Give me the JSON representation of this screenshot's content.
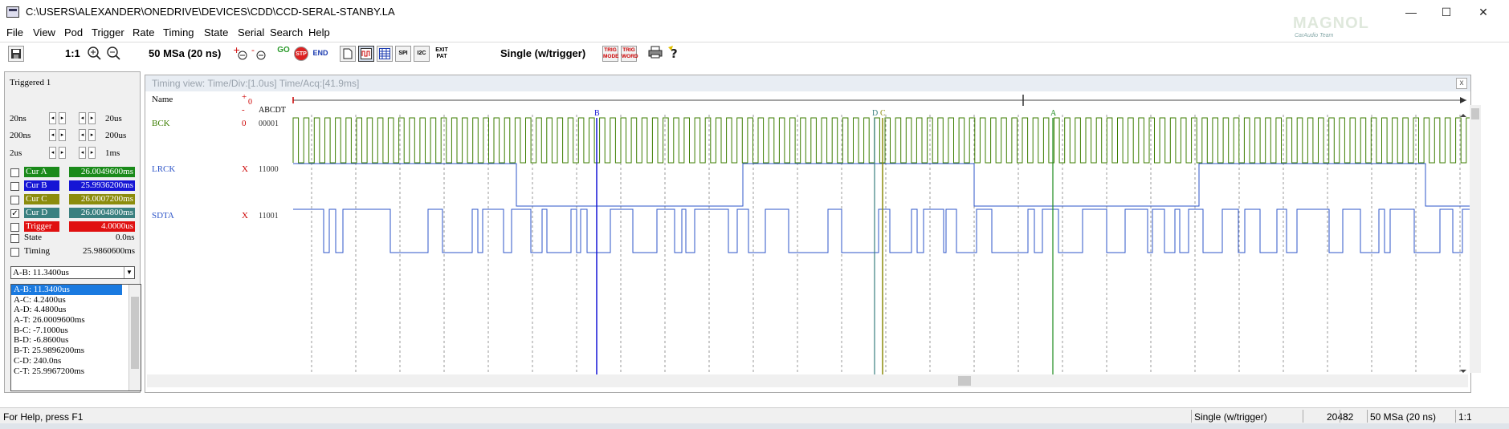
{
  "window": {
    "title": "C:\\USERS\\ALEXANDER\\ONEDRIVE\\DEVICES\\CDD\\CCD-SERAL-STANBY.LA",
    "min": "—",
    "max": "☐",
    "close": "✕",
    "logo": "MAGNOL",
    "logo_sub": "CarAudio Team"
  },
  "menu": [
    "File",
    "View",
    "Pod",
    "Trigger",
    "Rate",
    "Timing",
    "State",
    "Serial",
    "Search",
    "Help"
  ],
  "toolbar": {
    "zoom_ratio": "1:1",
    "rate": "50 MSa  (20 ns)",
    "mode": "Single (w/trigger)",
    "go": "GO",
    "stop": "STP",
    "end": "END",
    "exit_pat": "EXIT PAT",
    "trig_mode": "TRIG MODE",
    "trig_word": "TRIG WORD"
  },
  "left_panel": {
    "status": "Triggered 1",
    "steps": [
      {
        "left": "20ns",
        "right": "20us"
      },
      {
        "left": "200ns",
        "right": "200us"
      },
      {
        "left": "2us",
        "right": "1ms"
      }
    ],
    "cursors": [
      {
        "label": "Cur A",
        "value": "26.0049600ms",
        "checked": false,
        "label_color": "#1a8a1a",
        "value_color": "#1a8a1a"
      },
      {
        "label": "Cur B",
        "value": "25.9936200ms",
        "checked": false,
        "label_color": "#1515d5",
        "value_color": "#1515d5"
      },
      {
        "label": "Cur C",
        "value": "26.0007200ms",
        "checked": false,
        "label_color": "#8c8c0c",
        "value_color": "#8c8c0c"
      },
      {
        "label": "Cur D",
        "value": "26.0004800ms",
        "checked": true,
        "label_color": "#3a8080",
        "value_color": "#3a8080"
      },
      {
        "label": "Trigger",
        "value": "4.0000us",
        "checked": false,
        "label_color": "#e01010",
        "value_color": "#e01010"
      }
    ],
    "state_label": "State",
    "state_value": "0.0ns",
    "timing_label": "Timing",
    "timing_value": "25.9860600ms",
    "dropdown_value": "A-B: 11.3400us",
    "measurements": [
      "A-B: 11.3400us",
      "A-C: 4.2400us",
      "A-D: 4.4800us",
      "A-T: 26.0009600ms",
      "B-C: -7.1000us",
      "B-D: -6.8600us",
      "B-T: 25.9896200ms",
      "C-D: 240.0ns",
      "C-T: 25.9967200ms"
    ]
  },
  "timing_view": {
    "header": "Timing view:  Time/Div:[1.0us] Time/Acq:[41.9ms]",
    "close": "x",
    "name_header": "Name",
    "plus": "+",
    "zero": "0",
    "minus": "-",
    "cols_header": "ABCDT",
    "cursor_letters": {
      "b": "B",
      "d": "D",
      "c": "C",
      "a": "A"
    },
    "signals": [
      {
        "name": "BCK",
        "value_t": "0",
        "bits": "00001"
      },
      {
        "name": "LRCK",
        "value_t": "X",
        "bits": "11000"
      },
      {
        "name": "SDTA",
        "value_t": "X",
        "bits": "11001"
      }
    ],
    "colors": {
      "bck": "#3c7d00",
      "lrck": "#2e55c8",
      "sdta": "#2e55c8",
      "cur_a": "#1a8a1a",
      "cur_b": "#1515d5",
      "cur_c": "#8c8c0c",
      "cur_d": "#3a8080"
    }
  },
  "statusbar": {
    "help": "For Help, press F1",
    "mode": "Single (w/trigger)",
    "samples": "2048",
    "channels": "32",
    "rate": "50 MSa  (20 ns)",
    "zoom": "1:1"
  }
}
